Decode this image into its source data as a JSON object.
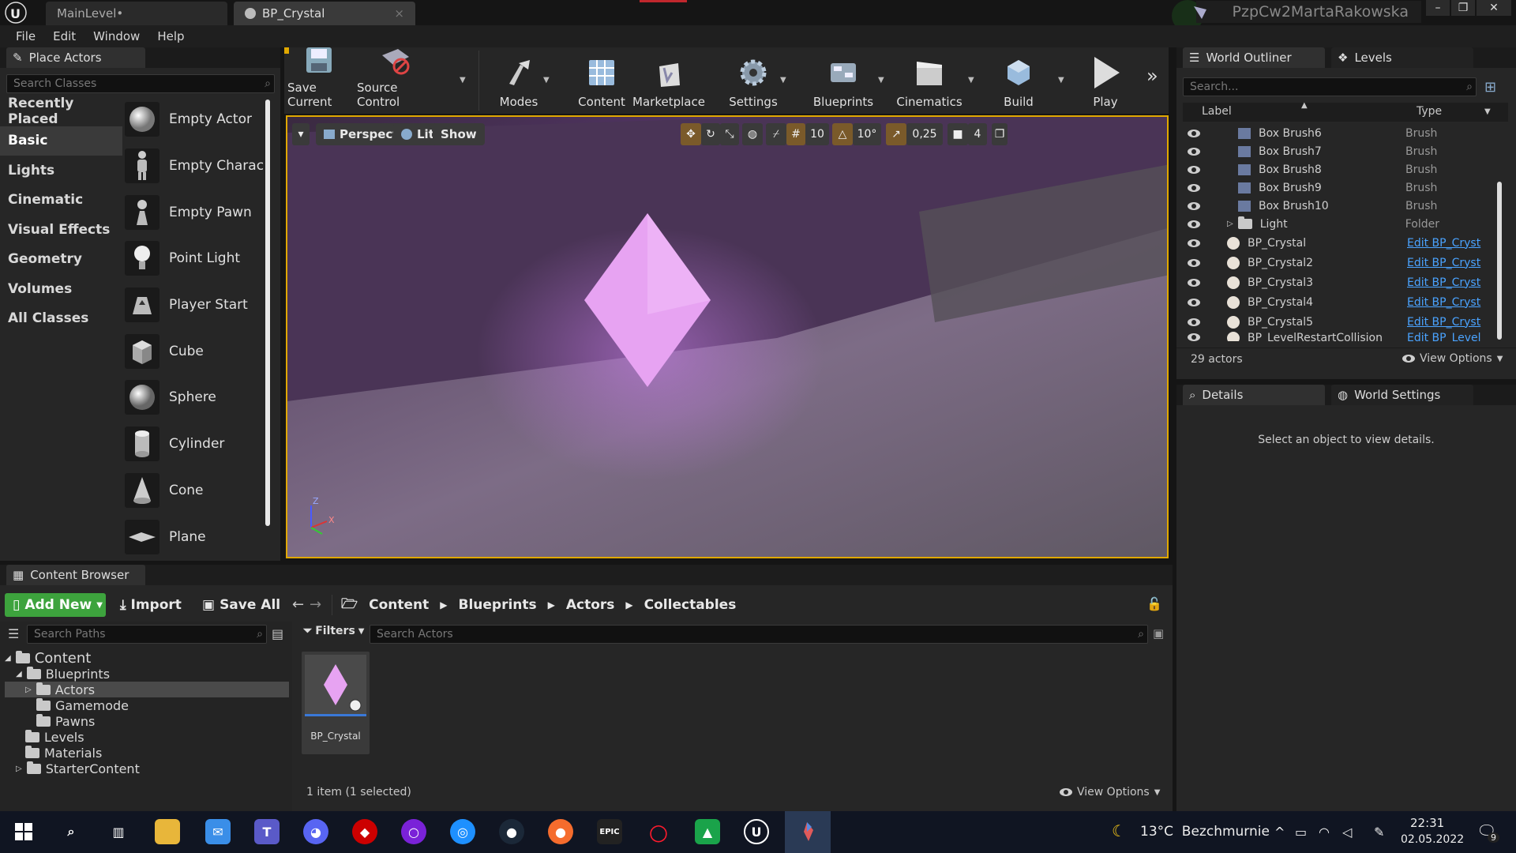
{
  "titlebar": {
    "tabs": [
      {
        "label": "MainLevel•"
      },
      {
        "label": "BP_Crystal"
      }
    ],
    "project_name": "PzpCw2MartaRakowska"
  },
  "menu": [
    "File",
    "Edit",
    "Window",
    "Help"
  ],
  "place_actors": {
    "title": "Place Actors",
    "search_placeholder": "Search Classes",
    "categories": [
      "Recently Placed",
      "Basic",
      "Lights",
      "Cinematic",
      "Visual Effects",
      "Geometry",
      "Volumes",
      "All Classes"
    ],
    "selected_category": "Basic",
    "actors": [
      "Empty Actor",
      "Empty Charac",
      "Empty Pawn",
      "Point Light",
      "Player Start",
      "Cube",
      "Sphere",
      "Cylinder",
      "Cone",
      "Plane"
    ]
  },
  "toolbar": {
    "items": [
      "Save Current",
      "Source Control",
      "Modes",
      "Content",
      "Marketplace",
      "Settings",
      "Blueprints",
      "Cinematics",
      "Build",
      "Play"
    ]
  },
  "viewport": {
    "perspective": "Perspective",
    "lit": "Lit",
    "show": "Show",
    "grid_snap": "10",
    "rot_snap": "10°",
    "scale_snap": "0,25",
    "cam_speed": "4"
  },
  "outliner": {
    "tab": "World Outliner",
    "tab2": "Levels",
    "search_placeholder": "Search...",
    "col_label": "Label",
    "col_type": "Type",
    "rows": [
      {
        "label": "Box Brush6",
        "type": "Brush"
      },
      {
        "label": "Box Brush7",
        "type": "Brush"
      },
      {
        "label": "Box Brush8",
        "type": "Brush"
      },
      {
        "label": "Box Brush9",
        "type": "Brush"
      },
      {
        "label": "Box Brush10",
        "type": "Brush"
      },
      {
        "label": "Light",
        "type": "Folder"
      },
      {
        "label": "BP_Crystal",
        "type": "Edit BP_Cryst"
      },
      {
        "label": "BP_Crystal2",
        "type": "Edit BP_Cryst"
      },
      {
        "label": "BP_Crystal3",
        "type": "Edit BP_Cryst"
      },
      {
        "label": "BP_Crystal4",
        "type": "Edit BP_Cryst"
      },
      {
        "label": "BP_Crystal5",
        "type": "Edit BP_Cryst"
      },
      {
        "label": "BP_LevelRestartCollision",
        "type": "Edit BP_Level"
      }
    ],
    "count": "29 actors",
    "view_options": "View Options"
  },
  "details": {
    "tab": "Details",
    "tab2": "World Settings",
    "empty": "Select an object to view details."
  },
  "content_browser": {
    "title": "Content Browser",
    "add_new": "Add New",
    "import": "Import",
    "save_all": "Save All",
    "breadcrumb": [
      "Content",
      "Blueprints",
      "Actors",
      "Collectables"
    ],
    "search_paths": "Search Paths",
    "filters": "Filters",
    "search_actors": "Search Actors",
    "tree": [
      {
        "label": "Content",
        "level": 0
      },
      {
        "label": "Blueprints",
        "level": 1
      },
      {
        "label": "Actors",
        "level": 2
      },
      {
        "label": "Gamemode",
        "level": 2
      },
      {
        "label": "Pawns",
        "level": 2
      },
      {
        "label": "Levels",
        "level": 1
      },
      {
        "label": "Materials",
        "level": 1
      },
      {
        "label": "StarterContent",
        "level": 1
      }
    ],
    "asset_name": "BP_Crystal",
    "status": "1 item (1 selected)",
    "view_options": "View Options"
  },
  "taskbar": {
    "weather": "13°C  Bezchmurnie",
    "time": "22:31",
    "date": "02.05.2022",
    "notifications": "9",
    "epic": "EPIC"
  },
  "colors": {
    "accent": "#e0a800",
    "crystal": "#e7a3f2",
    "link": "#4aa3ff",
    "addnew": "#3da33d"
  }
}
